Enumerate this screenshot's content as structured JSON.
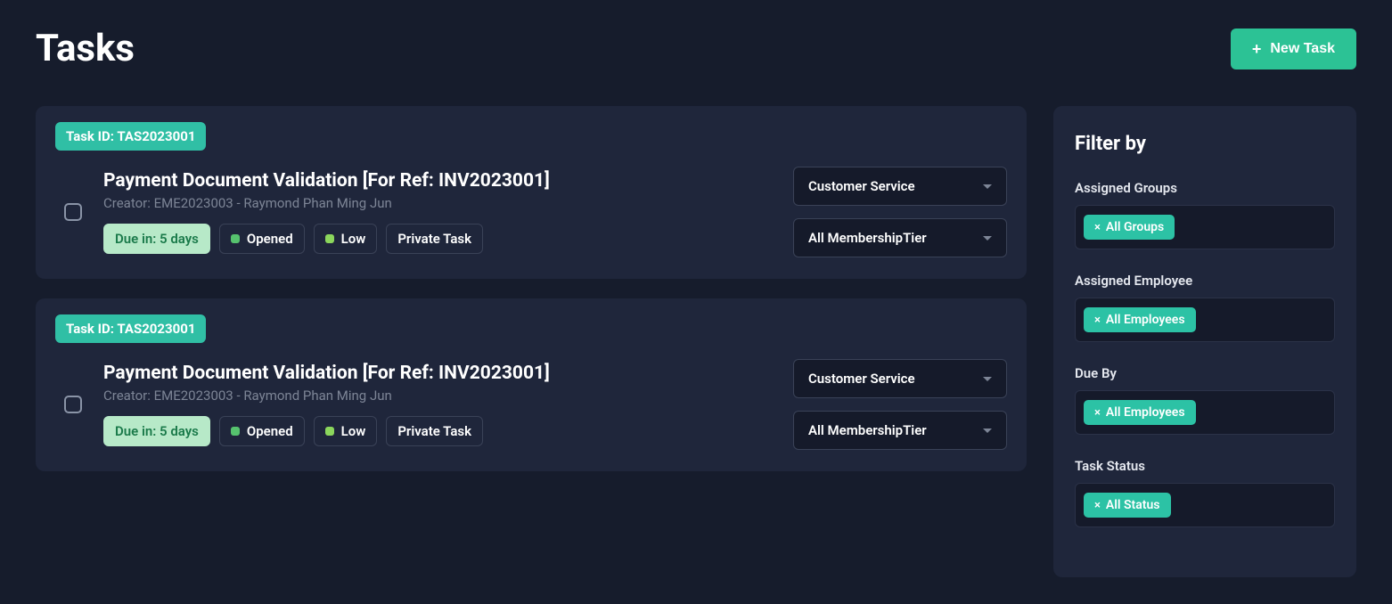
{
  "header": {
    "title": "Tasks",
    "newTaskLabel": "New Task"
  },
  "tasks": [
    {
      "idLabel": "Task ID: TAS2023001",
      "title": "Payment Document Validation [For Ref: INV2023001]",
      "creator": "Creator: EME2023003 - Raymond Phan Ming Jun",
      "due": "Due in: 5 days",
      "status": "Opened",
      "priority": "Low",
      "visibility": "Private Task",
      "select1": "Customer Service",
      "select2": "All MembershipTier"
    },
    {
      "idLabel": "Task ID: TAS2023001",
      "title": "Payment Document Validation [For Ref: INV2023001]",
      "creator": "Creator: EME2023003 - Raymond Phan Ming Jun",
      "due": "Due in: 5 days",
      "status": "Opened",
      "priority": "Low",
      "visibility": "Private Task",
      "select1": "Customer Service",
      "select2": "All MembershipTier"
    }
  ],
  "filter": {
    "heading": "Filter by",
    "groups": {
      "assignedGroups": {
        "label": "Assigned Groups",
        "chip": "All Groups"
      },
      "assignedEmployee": {
        "label": "Assigned Employee",
        "chip": "All Employees"
      },
      "dueBy": {
        "label": "Due By",
        "chip": "All Employees"
      },
      "taskStatus": {
        "label": "Task Status",
        "chip": "All Status"
      }
    }
  }
}
